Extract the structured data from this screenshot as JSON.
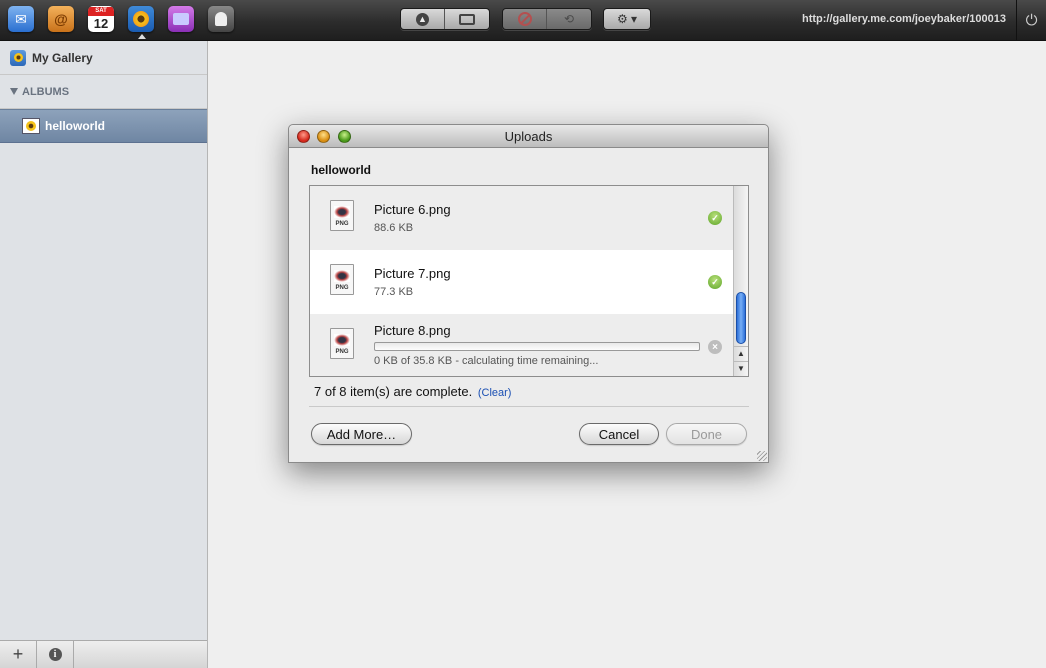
{
  "toolbar": {
    "apps": [
      {
        "name": "Mail",
        "icon": "mail-icon"
      },
      {
        "name": "Contacts",
        "icon": "at-sign-icon",
        "glyph": "@"
      },
      {
        "name": "Calendar",
        "icon": "calendar-icon",
        "weekday": "SAT",
        "day": "12"
      },
      {
        "name": "Gallery",
        "icon": "sunflower-icon",
        "active": true
      },
      {
        "name": "iDisk",
        "icon": "folder-icon"
      },
      {
        "name": "Find My",
        "icon": "person-icon"
      }
    ],
    "buttons": [
      "upload-icon",
      "slideshow-icon",
      "delete-icon",
      "share-icon",
      "gear-icon"
    ],
    "url": "http://gallery.me.com/joeybaker/100013",
    "power_icon": "power-icon"
  },
  "sidebar": {
    "title": "My Gallery",
    "albums_header": "ALBUMS",
    "albums": [
      {
        "label": "helloworld",
        "selected": true
      }
    ],
    "bottom_buttons": [
      {
        "icon": "plus-icon",
        "glyph": "+"
      },
      {
        "icon": "info-icon",
        "glyph": "i"
      }
    ]
  },
  "dialog": {
    "title": "Uploads",
    "album": "helloworld",
    "items": [
      {
        "name": "Picture 6.png",
        "size": "88.6 KB",
        "status": "complete",
        "type": "PNG"
      },
      {
        "name": "Picture 7.png",
        "size": "77.3 KB",
        "status": "complete",
        "type": "PNG"
      },
      {
        "name": "Picture 8.png",
        "progress_text": "0 KB of 35.8 KB - calculating time remaining...",
        "progress": 0,
        "status": "uploading",
        "type": "PNG"
      }
    ],
    "status_text": "7 of 8 item(s) are complete.",
    "clear_label": "(Clear)",
    "add_more_label": "Add More…",
    "cancel_label": "Cancel",
    "done_label": "Done"
  },
  "colors": {
    "accent": "#2d6fd8",
    "selection": "#7a8fab",
    "complete": "#5fa52a"
  }
}
